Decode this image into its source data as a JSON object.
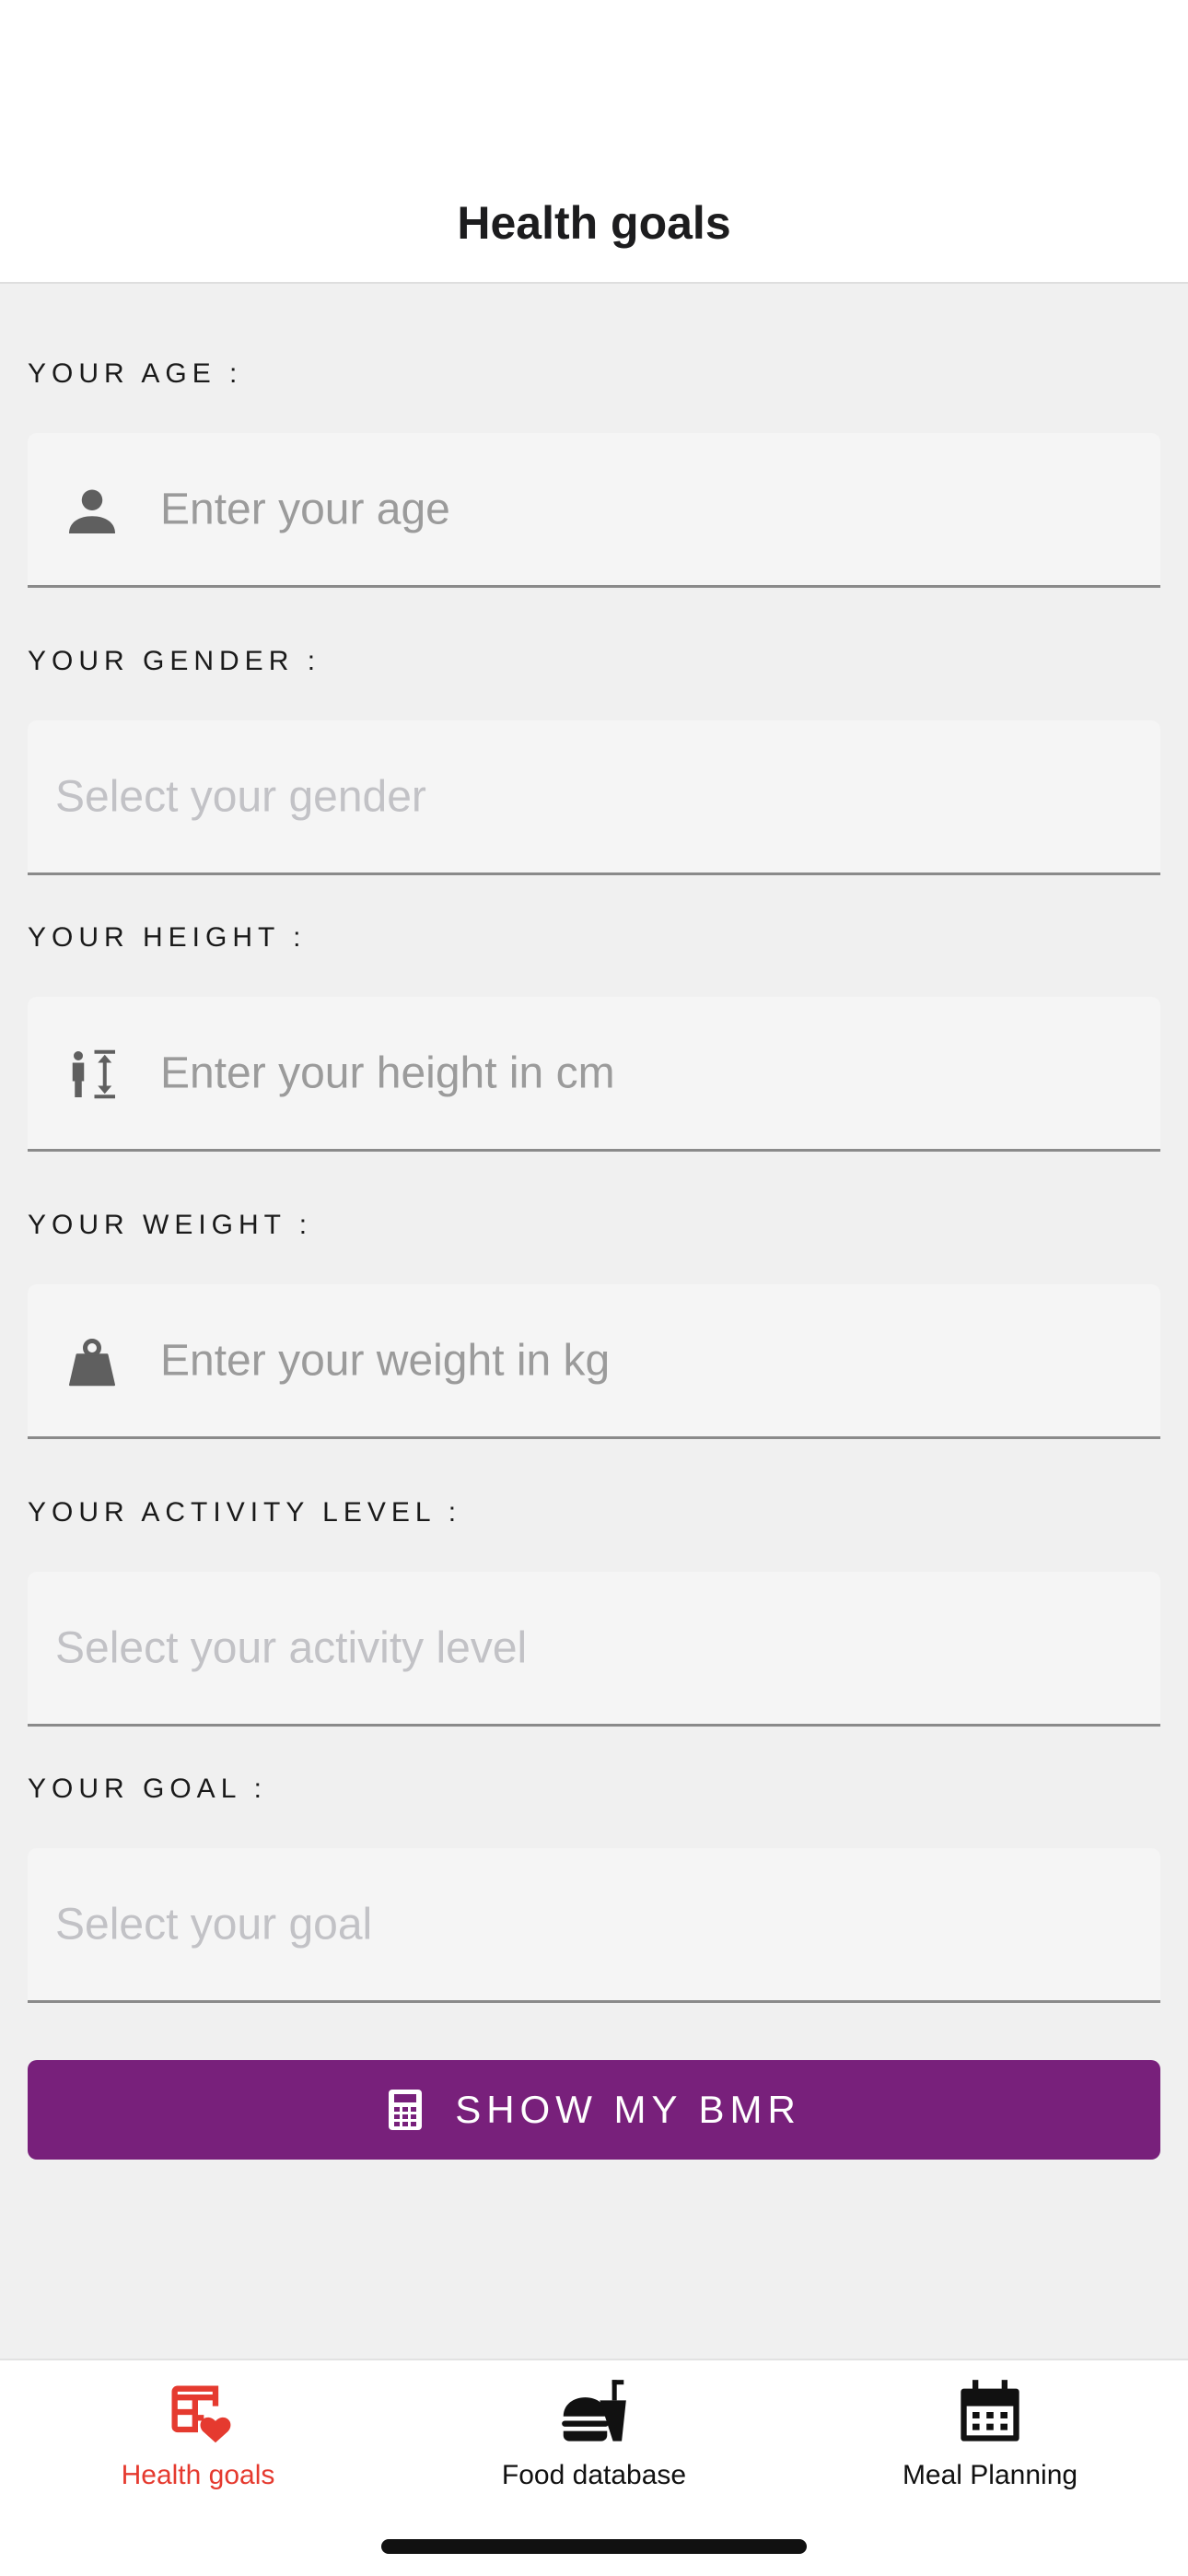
{
  "header": {
    "title": "Health goals"
  },
  "form": {
    "age": {
      "label": "YOUR AGE :",
      "placeholder": "Enter your age",
      "icon": "person-icon"
    },
    "gender": {
      "label": "YOUR GENDER :",
      "placeholder": "Select your gender"
    },
    "height": {
      "label": "YOUR HEIGHT :",
      "placeholder": "Enter your height in cm",
      "icon": "height-icon"
    },
    "weight": {
      "label": "YOUR WEIGHT :",
      "placeholder": "Enter your weight in kg",
      "icon": "weight-icon"
    },
    "activity": {
      "label": "YOUR ACTIVITY LEVEL :",
      "placeholder": "Select your activity level"
    },
    "goal": {
      "label": "YOUR GOAL :",
      "placeholder": "Select your goal"
    }
  },
  "button": {
    "label": "SHOW MY BMR",
    "icon": "calculator-icon",
    "color": "#78207b"
  },
  "tabs": [
    {
      "label": "Health goals",
      "icon": "health-goals-icon",
      "active": true
    },
    {
      "label": "Food database",
      "icon": "food-icon",
      "active": false
    },
    {
      "label": "Meal Planning",
      "icon": "calendar-icon",
      "active": false
    }
  ],
  "colors": {
    "accent": "#78207b",
    "active_tab": "#e53a2f",
    "background": "#f0f0f0"
  }
}
